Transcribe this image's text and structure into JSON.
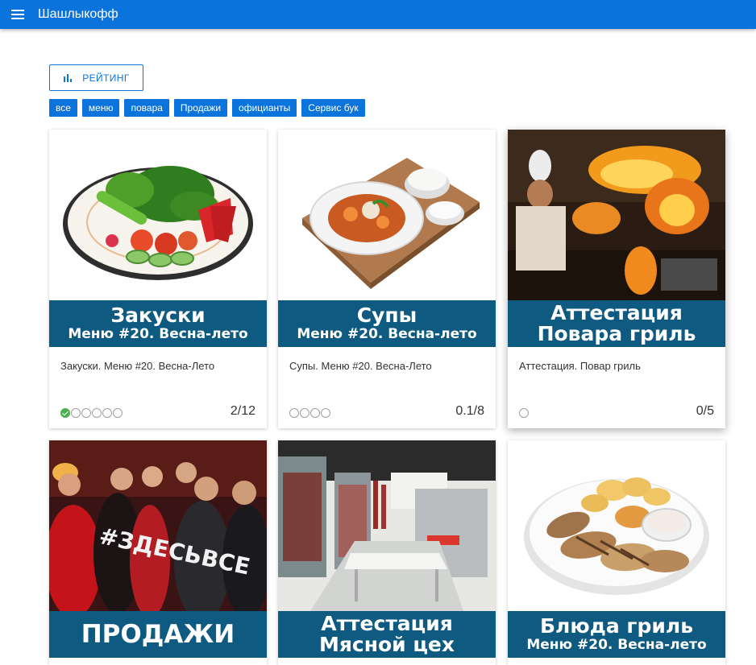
{
  "appbar": {
    "title": "Шашлыкофф",
    "menu_icon": "hamburger-menu-icon"
  },
  "rating_button": {
    "label": "РЕЙТИНГ",
    "icon": "bar-chart-icon"
  },
  "filters": [
    "все",
    "меню",
    "повара",
    "Продажи",
    "официанты",
    "Сервис бук"
  ],
  "colors": {
    "primary": "#0b73dc",
    "banner": "#0f5a80",
    "done": "#4caf50"
  },
  "cards": [
    {
      "title": "Закуски",
      "subtitle": "Меню #20. Весна-лето",
      "description": "Закуски. Меню #20. Весна-Лето",
      "score": "2/12",
      "progress": {
        "completed": 1,
        "total": 6
      }
    },
    {
      "title": "Супы",
      "subtitle": "Меню #20. Весна-лето",
      "description": "Супы. Меню #20. Весна-Лето",
      "score": "0.1/8",
      "progress": {
        "completed": 0,
        "total": 4
      }
    },
    {
      "title": "Аттестация",
      "subtitle": "Повара гриль",
      "description": "Аттестация. Повар гриль",
      "score": "0/5",
      "progress": {
        "completed": 0,
        "total": 1
      }
    },
    {
      "title": "ПРОДАЖИ",
      "subtitle": "",
      "image_text": "#ЗДЕСЬВСЕ"
    },
    {
      "title": "Аттестация",
      "subtitle": "Мясной цех"
    },
    {
      "title": "Блюда гриль",
      "subtitle": "Меню #20. Весна-лето"
    }
  ]
}
